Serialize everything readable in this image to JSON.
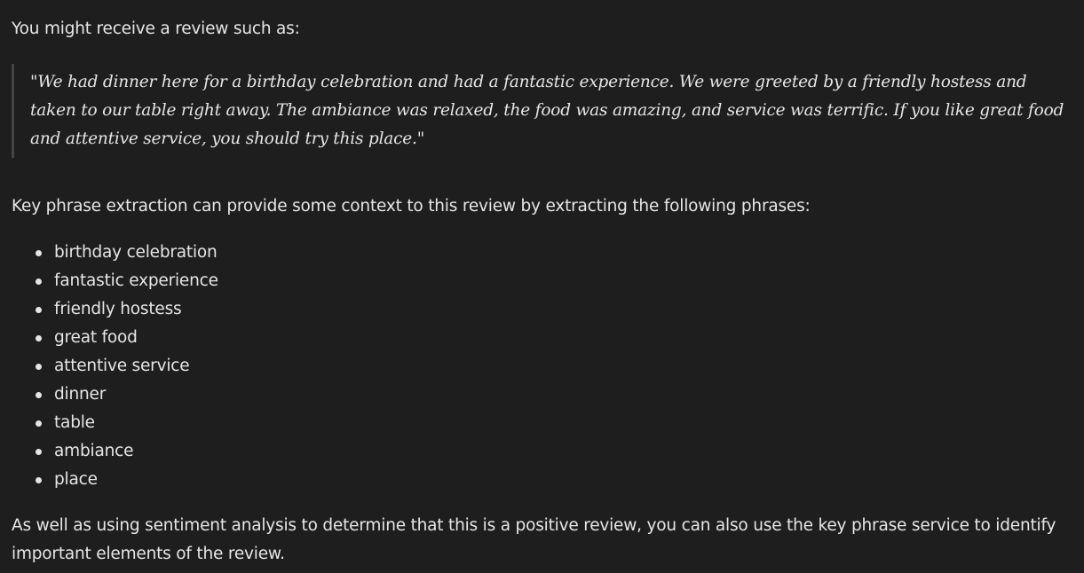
{
  "intro": "You might receive a review such as:",
  "review_quote": "\"We had dinner here for a birthday celebration and had a fantastic experience. We were greeted by a friendly hostess and taken to our table right away. The ambiance was relaxed, the food was amazing, and service was terrific. If you like great food and attentive service, you should try this place.\"",
  "lead": "Key phrase extraction can provide some context to this review by extracting the following phrases:",
  "phrases": [
    "birthday celebration",
    "fantastic experience",
    "friendly hostess",
    "great food",
    "attentive service",
    "dinner",
    "table",
    "ambiance",
    "place"
  ],
  "closing": "As well as using sentiment analysis to determine that this is a positive review, you can also use the key phrase service to identify important elements of the review."
}
